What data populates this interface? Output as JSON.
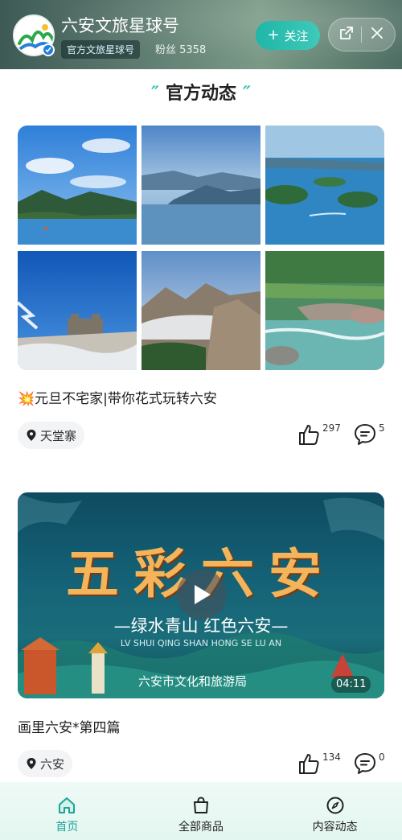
{
  "header": {
    "title": "六安文旅星球号",
    "tag": "官方文旅星球号",
    "fans": "粉丝 5358",
    "follow_label": "关注"
  },
  "section": {
    "title": "官方动态"
  },
  "posts": [
    {
      "title": "💥元旦不宅家|带你花式玩转六安",
      "location": "天堂寨",
      "likes": "297",
      "comments": "5"
    },
    {
      "title": "画里六安*第四篇",
      "location": "六安",
      "likes": "134",
      "comments": "0",
      "duration": "04:11",
      "video_title": "五彩六安",
      "video_subtitle": "—绿水青山 红色六安—",
      "video_pinyin": "LV SHUI QING SHAN HONG SE LU AN",
      "video_org": "六安市文化和旅游局"
    }
  ],
  "bottom_nav": [
    {
      "label": "首页",
      "icon": "home-icon",
      "active": true
    },
    {
      "label": "全部商品",
      "icon": "shopping-bag-icon",
      "active": false
    },
    {
      "label": "内容动态",
      "icon": "compass-icon",
      "active": false
    }
  ],
  "colors": {
    "accent": "#1aa596",
    "follow_button": "#2fc0b0"
  }
}
